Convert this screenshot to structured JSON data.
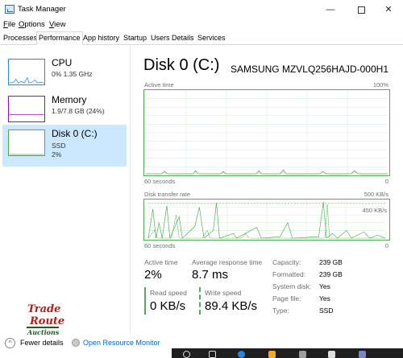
{
  "window": {
    "title": "Task Manager",
    "min_glyph": "—",
    "close_glyph": "✕"
  },
  "menu": [
    {
      "key": "F",
      "rest": "ile"
    },
    {
      "key": "O",
      "rest": "ptions"
    },
    {
      "key": "V",
      "rest": "iew"
    }
  ],
  "tabs": [
    "Processes",
    "Performance",
    "App history",
    "Startup",
    "Users",
    "Details",
    "Services"
  ],
  "active_tab": "Performance",
  "sidebar": {
    "cpu": {
      "title": "CPU",
      "sub": "0%  1.35 GHz",
      "color": "#1f8ad6"
    },
    "memory": {
      "title": "Memory",
      "sub": "1.9/7.8 GB (24%)",
      "color": "#8b12ae"
    },
    "disk": {
      "title": "Disk 0 (C:)",
      "sub1": "SSD",
      "sub2": "2%",
      "color": "#4caf50"
    }
  },
  "main": {
    "title": "Disk 0 (C:)",
    "model": "SAMSUNG MZVLQ256HAJD-000H1",
    "active_time_label": "Active time",
    "active_time_max": "100%",
    "active_axis_left": "60 seconds",
    "active_axis_right": "0",
    "transfer_label": "Disk transfer rate",
    "transfer_max": "500 KB/s",
    "transfer_mid": "450 KB/s",
    "transfer_axis_left": "60 seconds",
    "transfer_axis_right": "0"
  },
  "stats": {
    "active_time": {
      "label": "Active time",
      "value": "2%"
    },
    "avg_response": {
      "label": "Average response time",
      "value": "8.7 ms"
    },
    "read_speed": {
      "label": "Read speed",
      "value": "0 KB/s"
    },
    "write_speed": {
      "label": "Write speed",
      "value": "89.4 KB/s"
    }
  },
  "details": [
    {
      "label": "Capacity:",
      "value": "239 GB"
    },
    {
      "label": "Formatted:",
      "value": "239 GB"
    },
    {
      "label": "System disk:",
      "value": "Yes"
    },
    {
      "label": "Page file:",
      "value": "Yes"
    },
    {
      "label": "Type:",
      "value": "SSD"
    }
  ],
  "footer": {
    "fewer_details": "Fewer details",
    "resource_monitor": "Open Resource Monitor"
  },
  "watermark": {
    "line1": "Trade",
    "line2": "Route",
    "line3": "Auctions"
  },
  "colors": {
    "accent_green": "#4caf50",
    "selected_bg": "#cce8ff",
    "link": "#0066cc"
  }
}
